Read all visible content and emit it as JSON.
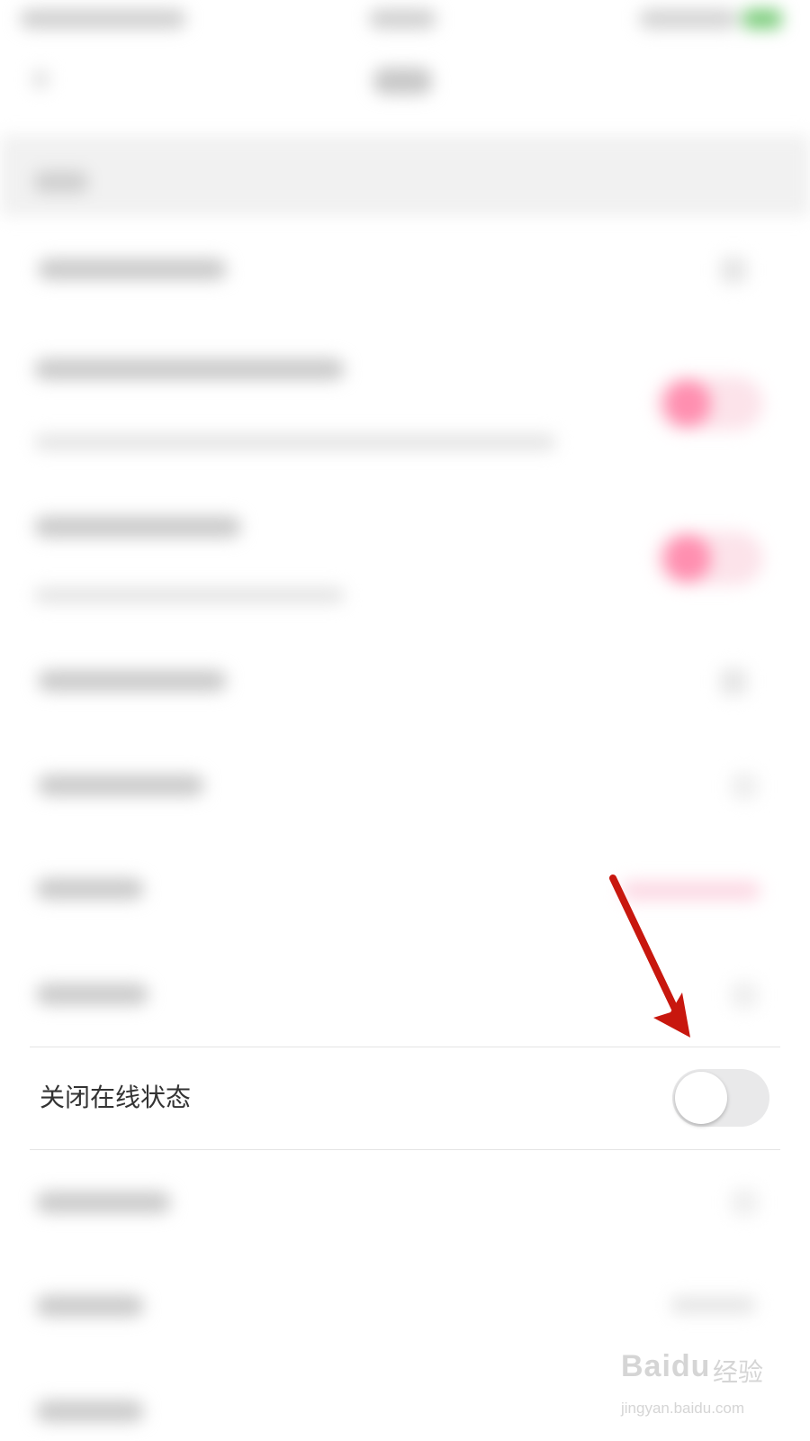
{
  "setting": {
    "label": "关闭在线状态",
    "enabled": false
  },
  "colors": {
    "toggle_track_off": "#e9e9ea",
    "toggle_thumb": "#ffffff",
    "accent_pink": "#ff8fb0",
    "annotation_arrow": "#c8170e"
  },
  "watermark": {
    "brand": "Baidu",
    "cn": "经验",
    "url": "jingyan.baidu.com"
  }
}
